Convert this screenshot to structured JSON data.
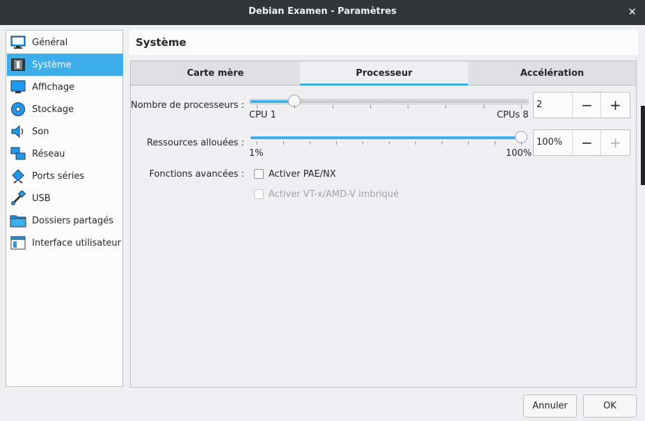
{
  "window": {
    "title": "Debian Examen - Paramètres",
    "close_glyph": "✕"
  },
  "sidebar": {
    "items": [
      {
        "label": "Général",
        "icon": "monitor-icon"
      },
      {
        "label": "Système",
        "icon": "chip-icon",
        "selected": true
      },
      {
        "label": "Affichage",
        "icon": "display-icon"
      },
      {
        "label": "Stockage",
        "icon": "disk-icon"
      },
      {
        "label": "Son",
        "icon": "speaker-icon"
      },
      {
        "label": "Réseau",
        "icon": "network-icon"
      },
      {
        "label": "Ports séries",
        "icon": "serial-port-icon"
      },
      {
        "label": "USB",
        "icon": "usb-icon"
      },
      {
        "label": "Dossiers partagés",
        "icon": "folder-icon"
      },
      {
        "label": "Interface utilisateur",
        "icon": "ui-window-icon"
      }
    ]
  },
  "header": {
    "title": "Système"
  },
  "tabs": [
    {
      "label": "Carte mère",
      "active": false
    },
    {
      "label": "Processeur",
      "active": true
    },
    {
      "label": "Accélération",
      "active": false
    }
  ],
  "processor": {
    "cpu_count": {
      "label": "Nombre de processeurs :",
      "min_label": "CPU 1",
      "max_label": "CPUs 8",
      "min": 1,
      "max": 8,
      "value": 2,
      "spin_value": "2"
    },
    "cap": {
      "label": "Ressources allouées :",
      "min_label": "1%",
      "max_label": "100%",
      "min": 1,
      "max": 100,
      "value": 100,
      "spin_value": "100%"
    },
    "features": {
      "label": "Fonctions avancées :",
      "pae": {
        "label": "Activer PAE/NX",
        "checked": false
      },
      "nested": {
        "label": "Activer VT-x/AMD-V imbriqué",
        "checked": false,
        "enabled": false
      }
    }
  },
  "spin_glyphs": {
    "minus": "−",
    "plus": "+"
  },
  "buttons": {
    "cancel": "Annuler",
    "ok": "OK"
  },
  "colors": {
    "accent": "#3daee9",
    "titlebar": "#31363b"
  }
}
